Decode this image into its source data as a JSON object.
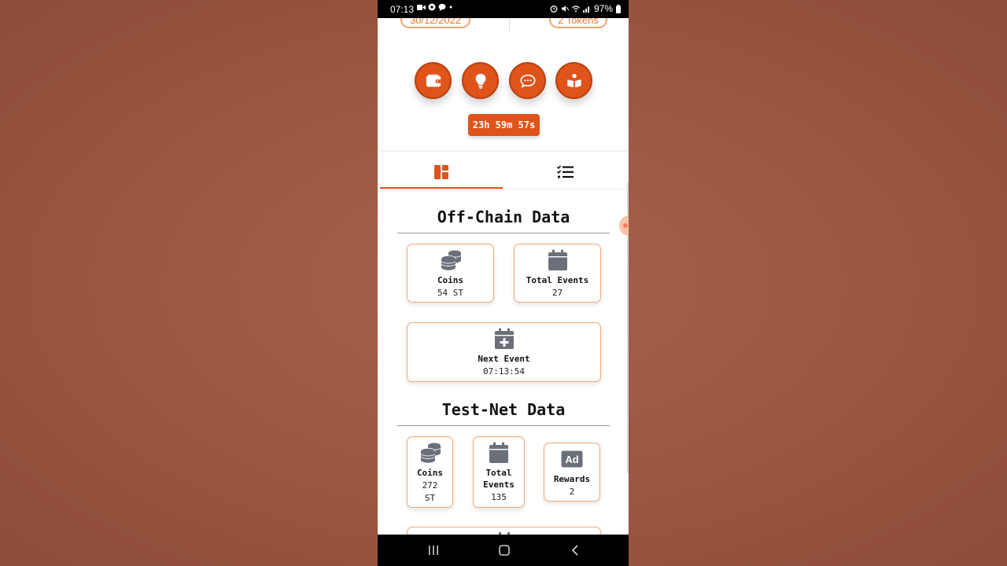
{
  "status_bar": {
    "time": "07:13",
    "battery": "97%"
  },
  "header": {
    "date_pill": "30/12/2022",
    "tokens_pill": "2 Tokens"
  },
  "actions": [
    {
      "name": "wallet",
      "icon": "wallet-icon"
    },
    {
      "name": "idea",
      "icon": "lightbulb-icon"
    },
    {
      "name": "chat",
      "icon": "chat-icon"
    },
    {
      "name": "guide",
      "icon": "book-reader-icon"
    }
  ],
  "timer": "23h 59m 57s",
  "tabs": [
    {
      "name": "dashboard",
      "icon": "dashboard-icon",
      "active": true
    },
    {
      "name": "tasks",
      "icon": "checklist-icon",
      "active": false
    }
  ],
  "off_chain": {
    "title": "Off-Chain Data",
    "coins": {
      "label": "Coins",
      "value": "54 ST"
    },
    "total_events": {
      "label": "Total Events",
      "value": "27"
    },
    "next_event": {
      "label": "Next Event",
      "value": "07:13:54"
    }
  },
  "test_net": {
    "title": "Test-Net Data",
    "coins": {
      "label": "Coins",
      "value_line1": "272",
      "value_line2": "ST"
    },
    "total_events": {
      "label_line1": "Total",
      "label_line2": "Events",
      "value": "135"
    },
    "rewards": {
      "label": "Rewards",
      "value": "2",
      "icon_text": "Ad"
    }
  },
  "colors": {
    "accent": "#e0531a",
    "card_border": "#f3a775",
    "icon_gray": "#6b6f78",
    "background": "#9a5640"
  }
}
